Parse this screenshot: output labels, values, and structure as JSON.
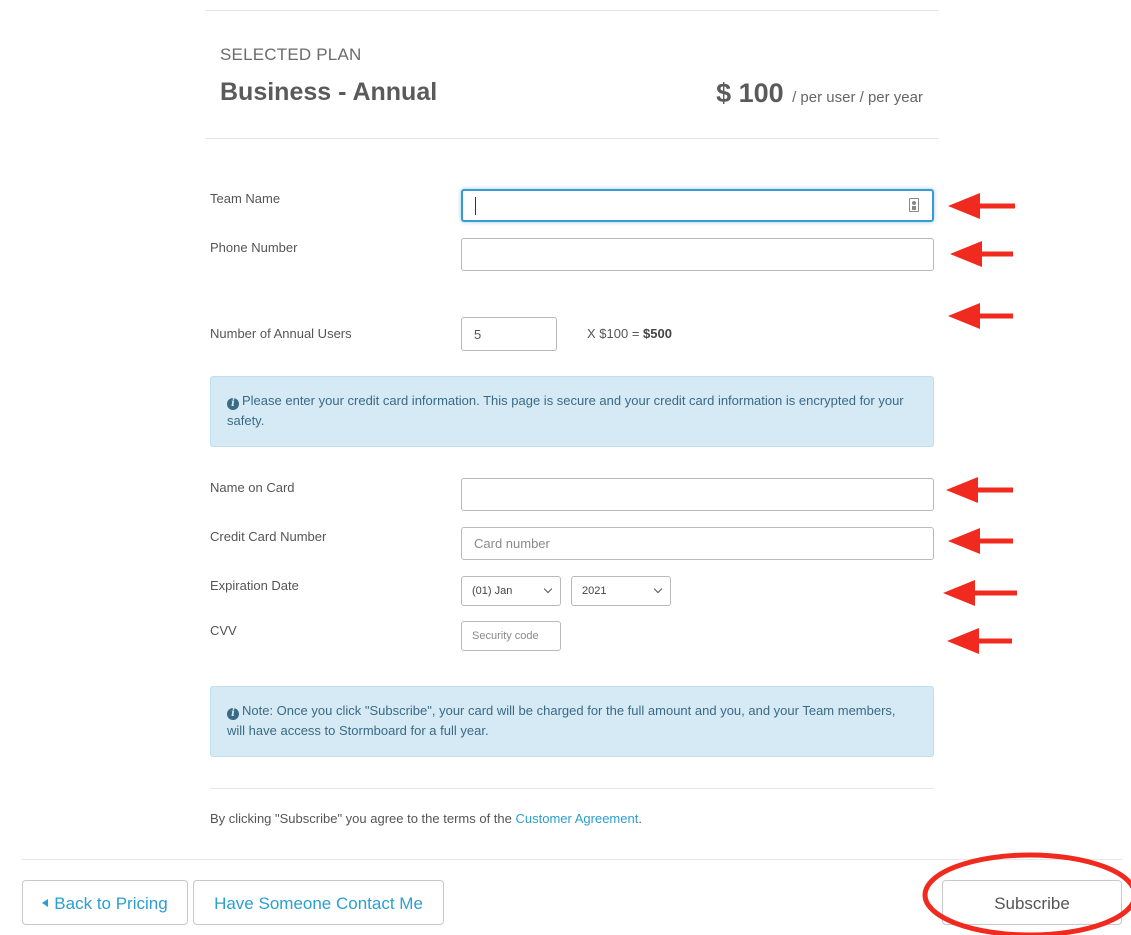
{
  "plan": {
    "section_label": "SELECTED PLAN",
    "name": "Business - Annual",
    "price": "$ 100",
    "price_unit": "/ per user / per year"
  },
  "form": {
    "team_name": {
      "label": "Team Name",
      "value": "",
      "placeholder": ""
    },
    "phone_number": {
      "label": "Phone Number",
      "value": "",
      "placeholder": ""
    },
    "annual_users": {
      "label": "Number of Annual Users",
      "value": "5"
    },
    "calc_prefix": "X $100 = ",
    "calc_total": "$500",
    "card_info_alert": "Please enter your credit card information. This page is secure and your credit card information is encrypted for your safety.",
    "name_on_card": {
      "label": "Name on Card",
      "value": "",
      "placeholder": ""
    },
    "card_number": {
      "label": "Credit Card Number",
      "value": "",
      "placeholder": "Card number"
    },
    "expiration": {
      "label": "Expiration Date",
      "month": "(01) Jan",
      "year": "2021"
    },
    "cvv": {
      "label": "CVV",
      "value": "",
      "placeholder": "Security code"
    },
    "note_alert": "Note: Once you click \"Subscribe\", your card will be charged for the full amount and you, and your Team members, will have access to Stormboard for a full year.",
    "terms_prefix": "By clicking \"Subscribe\" you agree to the terms of the ",
    "terms_link": "Customer Agreement",
    "terms_suffix": "."
  },
  "buttons": {
    "back": "Back to Pricing",
    "contact": "Have Someone Contact Me",
    "subscribe": "Subscribe"
  },
  "icons": {
    "info": "i",
    "annotation_color": "#f02a1e",
    "accent": "#2a9fd0",
    "focus_border": "#3a9bd0"
  }
}
